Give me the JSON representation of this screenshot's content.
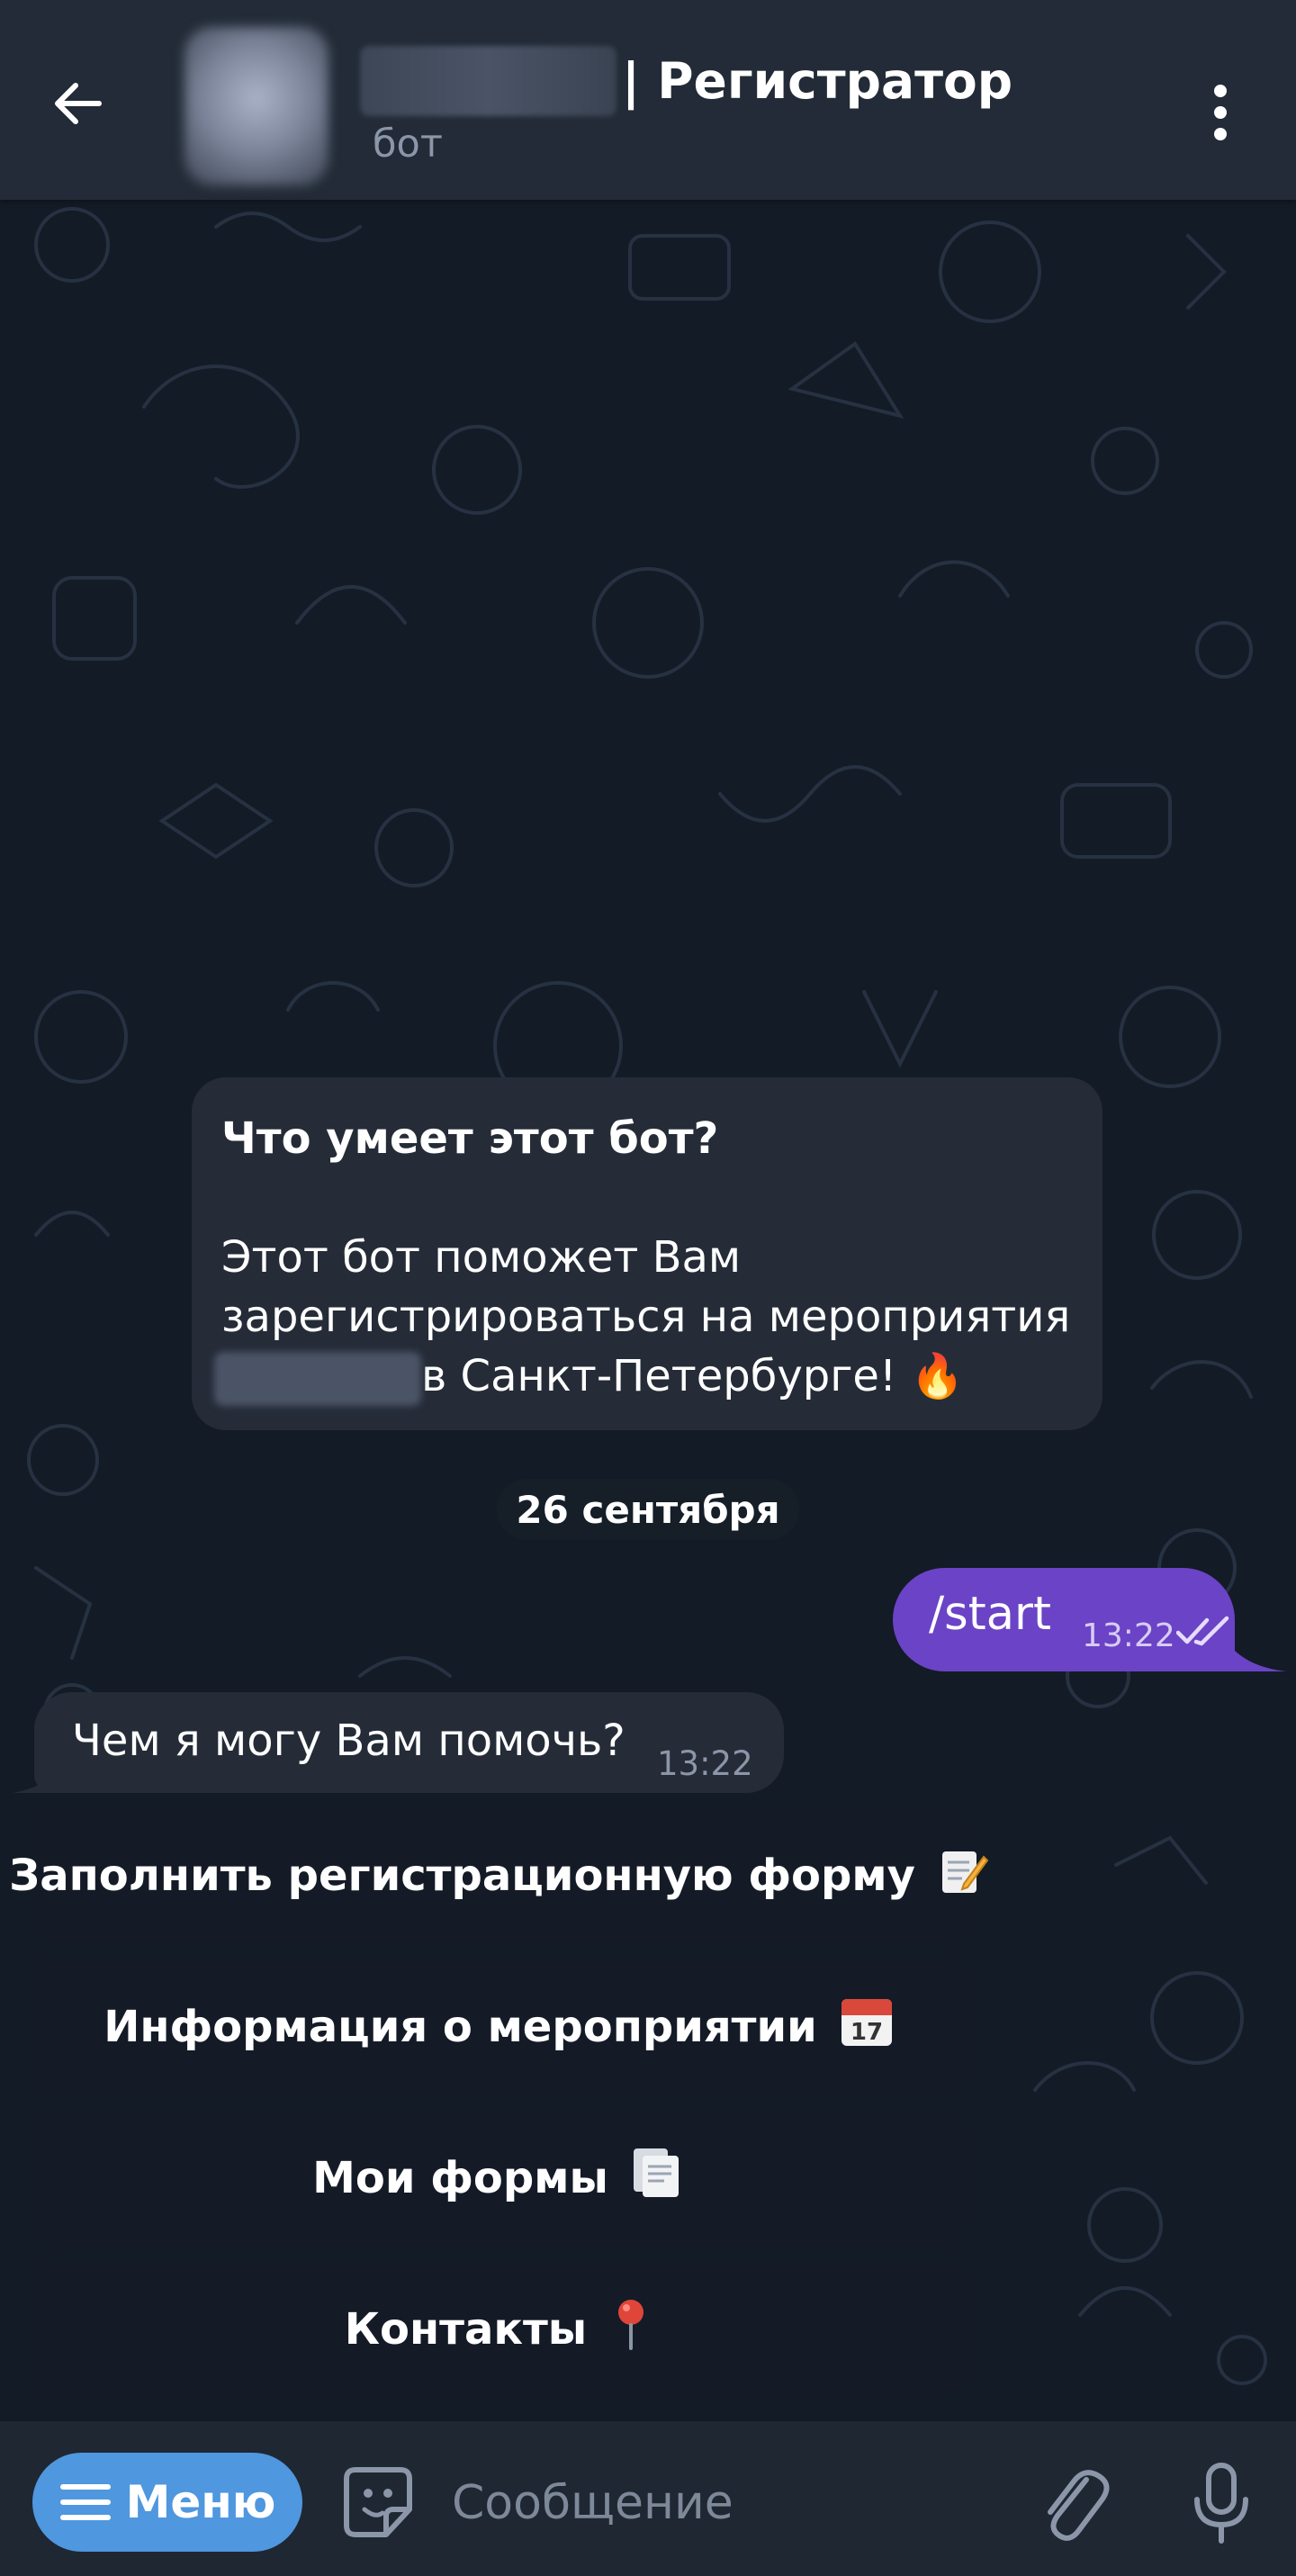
{
  "header": {
    "title_suffix": "| Регистратор",
    "subtitle": "бот"
  },
  "bot_info": {
    "title": "Что умеет этот бот?",
    "line1": "Этот бот поможет Вам",
    "line2": "зарегистрироваться на мероприятия",
    "line3": "в Санкт-Петербурге! 🔥"
  },
  "date_separator": "26 сентября",
  "outgoing": {
    "text": "/start",
    "time": "13:22"
  },
  "incoming": {
    "text": "Чем я могу Вам помочь?",
    "time": "13:22"
  },
  "keyboard": [
    {
      "label": "Заполнить регистрационную форму",
      "icon": "memo-icon"
    },
    {
      "label": "Информация о мероприятии",
      "icon": "calendar-icon"
    },
    {
      "label": "Мои формы",
      "icon": "documents-icon"
    },
    {
      "label": "Контакты",
      "icon": "pin-icon"
    }
  ],
  "composer": {
    "menu_label": "Меню",
    "placeholder": "Сообщение"
  },
  "colors": {
    "header_bg": "#222b37",
    "chat_bg": "#131b26",
    "outgoing_bubble": "#6b43c6",
    "incoming_bubble": "#252c38",
    "menu_button": "#4f97de"
  }
}
